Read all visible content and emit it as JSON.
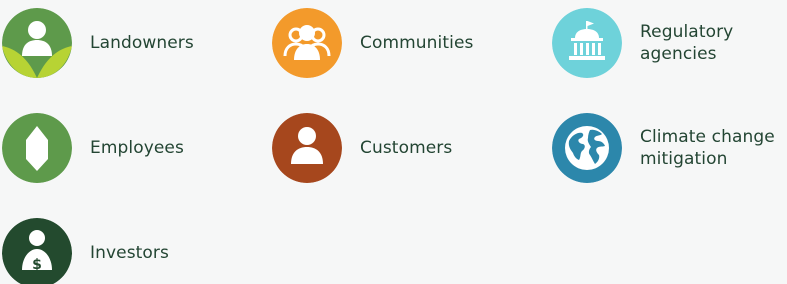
{
  "stakeholders": [
    {
      "label": "Landowners",
      "icon": "landowner-icon",
      "color": "#5e9a4b"
    },
    {
      "label": "Communities",
      "icon": "community-icon",
      "color": "#f39a2b"
    },
    {
      "label": "Regulatory\nagencies",
      "icon": "government-building-icon",
      "color": "#6ed2da"
    },
    {
      "label": "Employees",
      "icon": "leaf-icon",
      "color": "#5e9a4b"
    },
    {
      "label": "Customers",
      "icon": "customer-icon",
      "color": "#a6471d"
    },
    {
      "label": "Climate change\nmitigation",
      "icon": "globe-icon",
      "color": "#2c87ab"
    },
    {
      "label": "Investors",
      "icon": "investor-icon",
      "color": "#234a2e"
    }
  ]
}
